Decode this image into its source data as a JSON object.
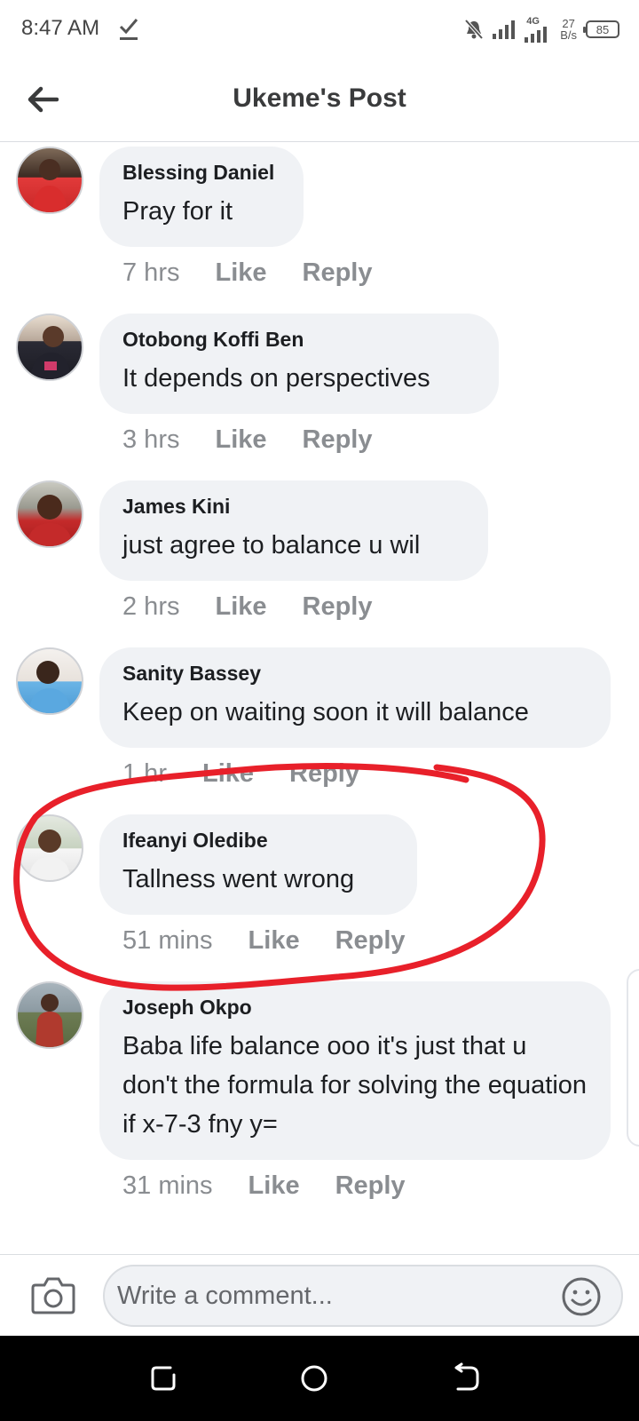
{
  "status_bar": {
    "time": "8:47 AM",
    "net_speed_value": "27",
    "net_speed_unit": "B/s",
    "network_type": "4G",
    "battery": "85"
  },
  "header": {
    "title": "Ukeme's Post",
    "back_icon": "arrow-left-icon"
  },
  "comments": [
    {
      "author": "Blessing Daniel",
      "text": "Pray for it",
      "time": "7 hrs",
      "like": "Like",
      "reply": "Reply"
    },
    {
      "author": "Otobong Koffi Ben",
      "text": "It depends on perspectives",
      "time": "3 hrs",
      "like": "Like",
      "reply": "Reply"
    },
    {
      "author": "James Kini",
      "text": "just agree to balance u wil",
      "time": "2 hrs",
      "like": "Like",
      "reply": "Reply"
    },
    {
      "author": "Sanity Bassey",
      "text": "Keep on waiting soon it will balance",
      "time": "1 hr",
      "like": "Like",
      "reply": "Reply"
    },
    {
      "author": "Ifeanyi Oledibe",
      "text": "Tallness went wrong",
      "time": "51 mins",
      "like": "Like",
      "reply": "Reply"
    },
    {
      "author": "Joseph Okpo",
      "text": "Baba life balance ooo it's just that u don't the formula for solving the equation if x-7-3 fny y=",
      "time": "31 mins",
      "like": "Like",
      "reply": "Reply"
    }
  ],
  "composer": {
    "placeholder": "Write a comment...",
    "camera_icon": "camera-icon",
    "emoji_icon": "smiley-icon"
  },
  "colors": {
    "bubble": "#f0f2f5",
    "meta_text": "#8a8d91",
    "annotation": "#e8202a"
  }
}
